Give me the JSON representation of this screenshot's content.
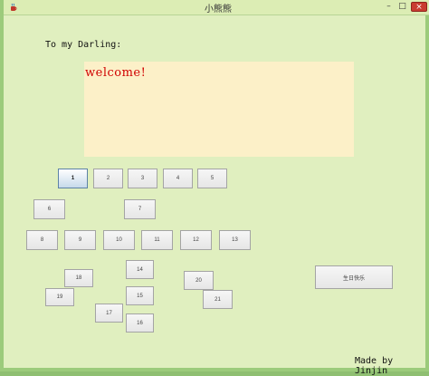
{
  "window": {
    "title": "小熊熊",
    "minimize": "–",
    "maximize": "□",
    "close": "×"
  },
  "heading": "To my Darling:",
  "message": "welcome!",
  "buttons": {
    "b1": "1",
    "b2": "2",
    "b3": "3",
    "b4": "4",
    "b5": "5",
    "b6": "6",
    "b7": "7",
    "b8": "8",
    "b9": "9",
    "b10": "10",
    "b11": "11",
    "b12": "12",
    "b13": "13",
    "b14": "14",
    "b15": "15",
    "b16": "16",
    "b17": "17",
    "b18": "18",
    "b19": "19",
    "b20": "20",
    "b21": "21"
  },
  "birthday_button": "生日快乐",
  "footer": "Made by Jinjin",
  "colors": {
    "background": "#e0efbf",
    "message_bg": "#fcf0c8",
    "message_text": "#d00000"
  }
}
